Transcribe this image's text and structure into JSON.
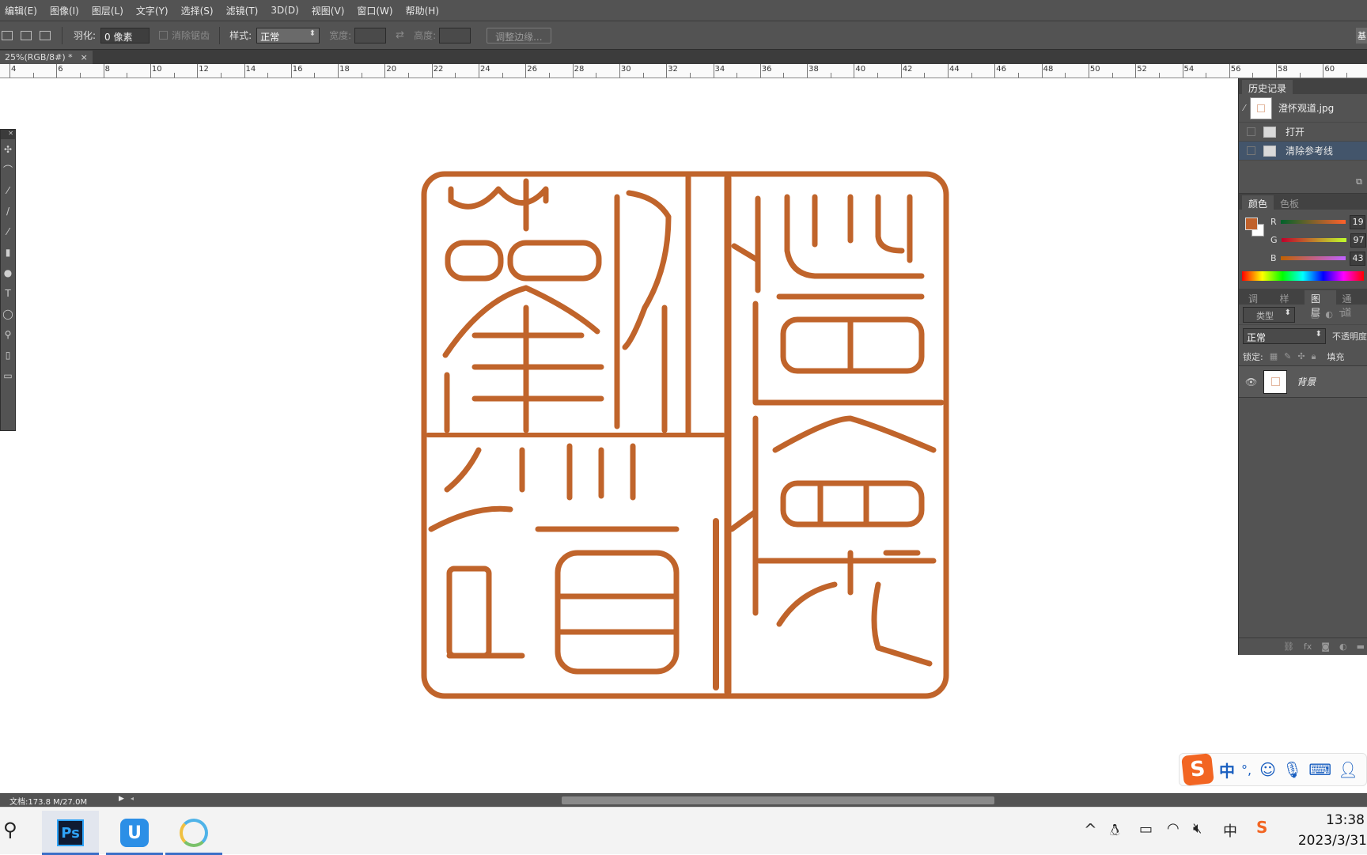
{
  "menu": [
    "编辑(E)",
    "图像(I)",
    "图层(L)",
    "文字(Y)",
    "选择(S)",
    "滤镜(T)",
    "3D(D)",
    "视图(V)",
    "窗口(W)",
    "帮助(H)"
  ],
  "options": {
    "feather_label": "羽化:",
    "feather_value": "0 像素",
    "antialias_label": "消除锯齿",
    "style_label": "样式:",
    "style_value": "正常",
    "width_label": "宽度:",
    "height_label": "高度:",
    "refine_edge_button": "调整边缘...",
    "right_fragment": "基"
  },
  "doc_tab": {
    "title": "25%(RGB/8#) *",
    "close": "×"
  },
  "ruler_numbers": [
    "4",
    "6",
    "8",
    "10",
    "12",
    "14",
    "16",
    "18",
    "20",
    "22",
    "24",
    "26",
    "28",
    "30",
    "32",
    "34",
    "36",
    "38",
    "40",
    "42",
    "44",
    "46",
    "48",
    "50",
    "52",
    "54",
    "56",
    "58",
    "60"
  ],
  "seal": {
    "color": "#c0642b",
    "characters": [
      "澄",
      "怀",
      "观",
      "道"
    ]
  },
  "history": {
    "tab": "历史记录",
    "snapshot": "澄怀观道.jpg",
    "items": [
      "打开",
      "清除参考线"
    ]
  },
  "color_panel": {
    "tabs": [
      "颜色",
      "色板"
    ],
    "foreground": "#c0612b",
    "channels": [
      {
        "label": "R",
        "value": "19"
      },
      {
        "label": "G",
        "value": "97"
      },
      {
        "label": "B",
        "value": "43"
      }
    ]
  },
  "layers_panel": {
    "tabs": [
      "调整",
      "样式",
      "图层",
      "通道"
    ],
    "filter": "类型",
    "blend_mode": "正常",
    "opacity_label": "不透明度",
    "lock_label": "锁定:",
    "fill_label": "填充",
    "layer_name": "背景"
  },
  "status": {
    "doc": "文档:173.8 M/27.0M"
  },
  "taskbar": {
    "apps": [
      "Ps",
      "U",
      ""
    ],
    "time": "13:38",
    "date": "2023/3/31",
    "ime_char": "中"
  },
  "ime_toolbar": {
    "logo": "S",
    "mode": "中",
    "punct": "°,"
  }
}
